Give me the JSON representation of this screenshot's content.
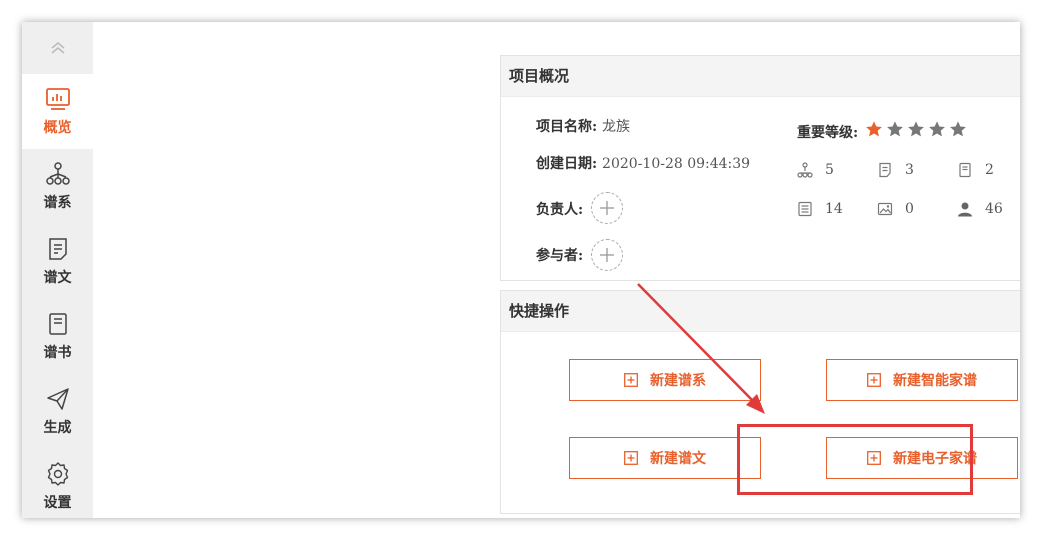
{
  "sidebar": {
    "items": [
      {
        "label": "概览",
        "icon": "chart-monitor-icon",
        "active": true
      },
      {
        "label": "谱系",
        "icon": "hierarchy-icon"
      },
      {
        "label": "谱文",
        "icon": "document-icon"
      },
      {
        "label": "谱书",
        "icon": "book-icon"
      },
      {
        "label": "生成",
        "icon": "paper-plane-icon"
      },
      {
        "label": "设置",
        "icon": "gear-icon"
      }
    ]
  },
  "overview": {
    "title": "项目概况",
    "name_label": "项目名称:",
    "name_value": "龙族",
    "date_label": "创建日期:",
    "date_value": "2020-10-28 09:44:39",
    "owner_label": "负责人:",
    "participants_label": "参与者:",
    "importance_label": "重要等级:",
    "importance_rating": 1,
    "importance_max": 5,
    "stats": [
      {
        "icon": "hierarchy-icon",
        "value": "5"
      },
      {
        "icon": "document-icon",
        "value": "3"
      },
      {
        "icon": "book-icon",
        "value": "2"
      },
      {
        "icon": "list-icon",
        "value": "14"
      },
      {
        "icon": "image-icon",
        "value": "0"
      },
      {
        "icon": "user-icon",
        "value": "46"
      }
    ]
  },
  "quick": {
    "title": "快捷操作",
    "buttons": [
      {
        "label": "新建谱系"
      },
      {
        "label": "新建智能家谱"
      },
      {
        "label": "新建谱文"
      },
      {
        "label": "新建电子家谱"
      }
    ]
  },
  "colors": {
    "accent": "#e8602c",
    "annotation": "#e03a3a",
    "star_off": "#777777"
  }
}
